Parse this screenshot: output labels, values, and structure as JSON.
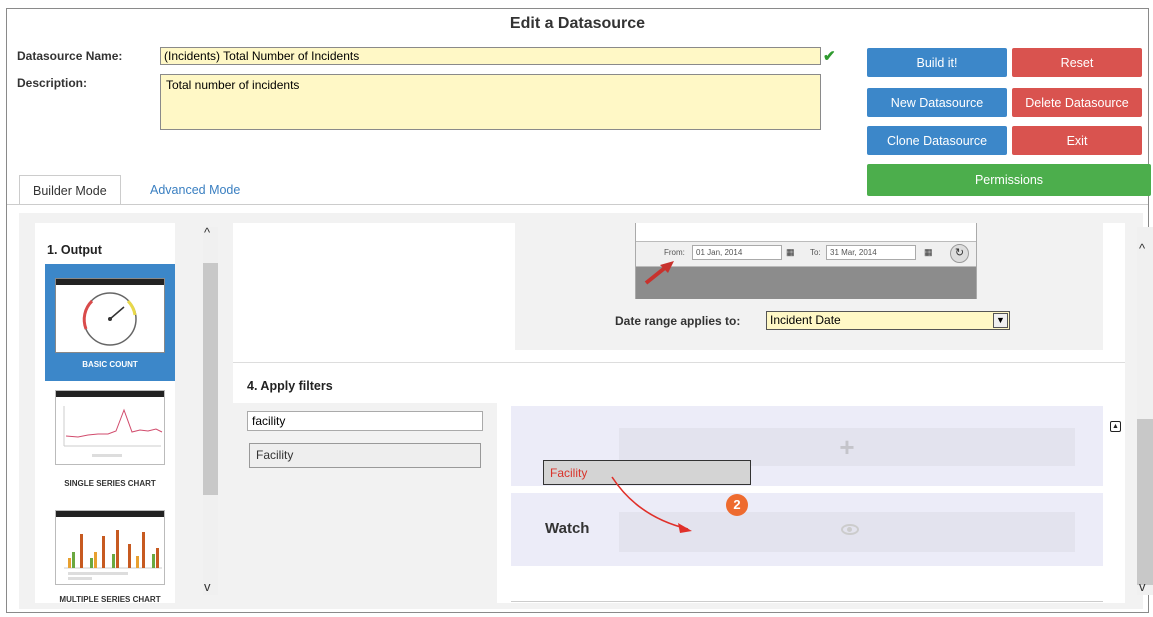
{
  "title": "Edit a Datasource",
  "form": {
    "name_label": "Datasource Name:",
    "name_value": "(Incidents) Total Number of Incidents",
    "desc_label": "Description:",
    "desc_value": "Total number of incidents"
  },
  "buttons": {
    "build": "Build it!",
    "reset": "Reset",
    "new": "New Datasource",
    "delete": "Delete Datasource",
    "clone": "Clone Datasource",
    "exit": "Exit",
    "permissions": "Permissions"
  },
  "tabs": [
    {
      "label": "Builder Mode",
      "active": true
    },
    {
      "label": "Advanced Mode",
      "active": false
    }
  ],
  "output": {
    "section_title": "1. Output",
    "options": [
      {
        "label": "BASIC COUNT",
        "selected": true
      },
      {
        "label": "SINGLE SERIES CHART",
        "selected": false
      },
      {
        "label": "MULTIPLE SERIES CHART",
        "selected": false
      }
    ]
  },
  "date_range": {
    "from_label": "From:",
    "from_value": "01 Jan, 2014",
    "to_label": "To:",
    "to_value": "31 Mar, 2014",
    "applies_label": "Date range applies to:",
    "applies_value": "Incident Date"
  },
  "filters": {
    "section_title": "4. Apply filters",
    "search_value": "facility",
    "items": [
      "Facility"
    ],
    "add_glyph": "+",
    "watch_label": "Watch",
    "drag_item": "Facility",
    "step_marker": "2"
  },
  "colors": {
    "primary": "#3c87c9",
    "danger": "#d9534f",
    "success": "#4cae4c",
    "input_bg": "#fff8c6",
    "annotation": "#e0302a"
  },
  "icons": [
    "check-icon",
    "calendar-icon",
    "refresh-icon",
    "plus-icon",
    "eye-icon",
    "collapse-icon",
    "scroll-up-icon",
    "scroll-down-icon"
  ]
}
